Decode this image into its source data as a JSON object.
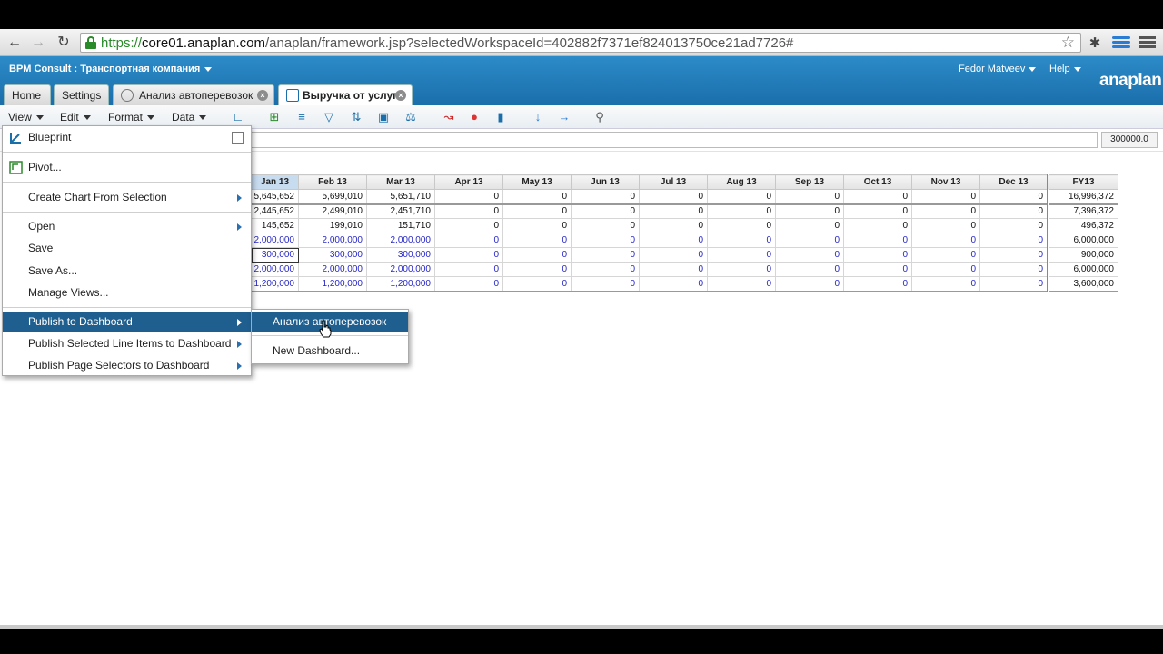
{
  "browser": {
    "url_scheme": "https://",
    "url_host": "core01.anaplan.com",
    "url_path": "/anaplan/framework.jsp?selectedWorkspaceId=402882f7371ef824013750ce21ad7726#"
  },
  "header": {
    "workspace": "BPM Consult : Транспортная компания",
    "user": "Fedor Matveev",
    "help": "Help",
    "logo": "anaplan"
  },
  "tabs": [
    {
      "label": "Home"
    },
    {
      "label": "Settings"
    },
    {
      "label": "Анализ автоперевозок"
    },
    {
      "label": "Выручка от услуг"
    }
  ],
  "toolbar": {
    "view": "View",
    "edit": "Edit",
    "format": "Format",
    "data": "Data"
  },
  "cell_value": "300000.0",
  "grid": {
    "columns": [
      "Jan 13",
      "Feb 13",
      "Mar 13",
      "Apr 13",
      "May 13",
      "Jun 13",
      "Jul 13",
      "Aug 13",
      "Sep 13",
      "Oct 13",
      "Nov 13",
      "Dec 13",
      "FY13"
    ],
    "rows": [
      [
        "5,645,652",
        "5,699,010",
        "5,651,710",
        "0",
        "0",
        "0",
        "0",
        "0",
        "0",
        "0",
        "0",
        "0",
        "16,996,372"
      ],
      [
        "2,445,652",
        "2,499,010",
        "2,451,710",
        "0",
        "0",
        "0",
        "0",
        "0",
        "0",
        "0",
        "0",
        "0",
        "7,396,372"
      ],
      [
        "145,652",
        "199,010",
        "151,710",
        "0",
        "0",
        "0",
        "0",
        "0",
        "0",
        "0",
        "0",
        "0",
        "496,372"
      ],
      [
        "2,000,000",
        "2,000,000",
        "2,000,000",
        "0",
        "0",
        "0",
        "0",
        "0",
        "0",
        "0",
        "0",
        "0",
        "6,000,000"
      ],
      [
        "300,000",
        "300,000",
        "300,000",
        "0",
        "0",
        "0",
        "0",
        "0",
        "0",
        "0",
        "0",
        "0",
        "900,000"
      ],
      [
        "2,000,000",
        "2,000,000",
        "2,000,000",
        "0",
        "0",
        "0",
        "0",
        "0",
        "0",
        "0",
        "0",
        "0",
        "6,000,000"
      ],
      [
        "1,200,000",
        "1,200,000",
        "1,200,000",
        "0",
        "0",
        "0",
        "0",
        "0",
        "0",
        "0",
        "0",
        "0",
        "3,600,000"
      ]
    ]
  },
  "context_menu": {
    "blueprint": "Blueprint",
    "pivot": "Pivot...",
    "create_chart": "Create Chart From Selection",
    "open": "Open",
    "save": "Save",
    "save_as": "Save As...",
    "manage_views": "Manage Views...",
    "publish_dashboard": "Publish to Dashboard",
    "publish_line_items": "Publish Selected Line Items to Dashboard",
    "publish_page_selectors": "Publish Page Selectors to Dashboard"
  },
  "submenu": {
    "existing_dashboard": "Анализ автоперевозок",
    "new_dashboard": "New Dashboard..."
  },
  "colors": {
    "header_blue": "#1a6eaa",
    "menu_highlight": "#1f5f8f",
    "input_blue": "#2727c8"
  }
}
